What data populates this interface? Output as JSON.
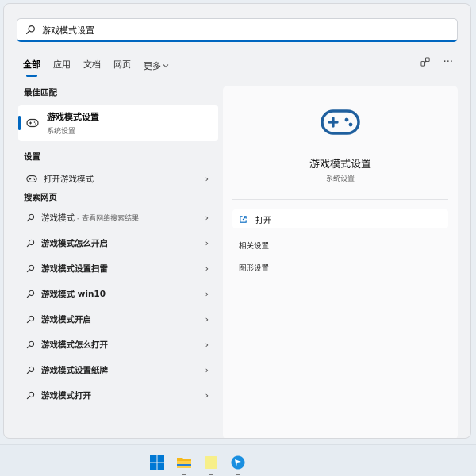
{
  "search": {
    "query": "游戏模式设置"
  },
  "tabs": [
    {
      "label": "全部"
    },
    {
      "label": "应用"
    },
    {
      "label": "文档"
    },
    {
      "label": "网页"
    },
    {
      "label": "更多"
    }
  ],
  "top_icons": {
    "more": "···"
  },
  "left": {
    "best_match_header": "最佳匹配",
    "best_match": {
      "title": "游戏模式设置",
      "subtitle": "系统设置"
    },
    "settings_header": "设置",
    "settings_items": [
      {
        "label": "打开游戏模式"
      }
    ],
    "web_header": "搜索网页",
    "web_items": [
      {
        "label": "游戏模式",
        "hint": "- 查看网络搜索结果"
      },
      {
        "label": "游戏模式怎么开启"
      },
      {
        "label": "游戏模式设置扫雷"
      },
      {
        "label": "游戏模式 win10"
      },
      {
        "label": "游戏模式开启"
      },
      {
        "label": "游戏模式怎么打开"
      },
      {
        "label": "游戏模式设置纸牌"
      },
      {
        "label": "游戏模式打开"
      }
    ]
  },
  "right": {
    "title": "游戏模式设置",
    "subtitle": "系统设置",
    "open_label": "打开",
    "related_label": "相关设置",
    "graphics_label": "图形设置"
  },
  "colors": {
    "accent": "#0067c0",
    "icon_blue": "#1f5f9e"
  },
  "icons": {
    "search": "search-icon",
    "gamepad": "gamepad-icon",
    "chevron": "chevron-right-icon",
    "open": "open-external-icon",
    "share": "share-icon",
    "windows": "windows-logo-icon",
    "explorer": "file-explorer-icon",
    "notes": "sticky-notes-icon",
    "browser": "browser-icon"
  }
}
